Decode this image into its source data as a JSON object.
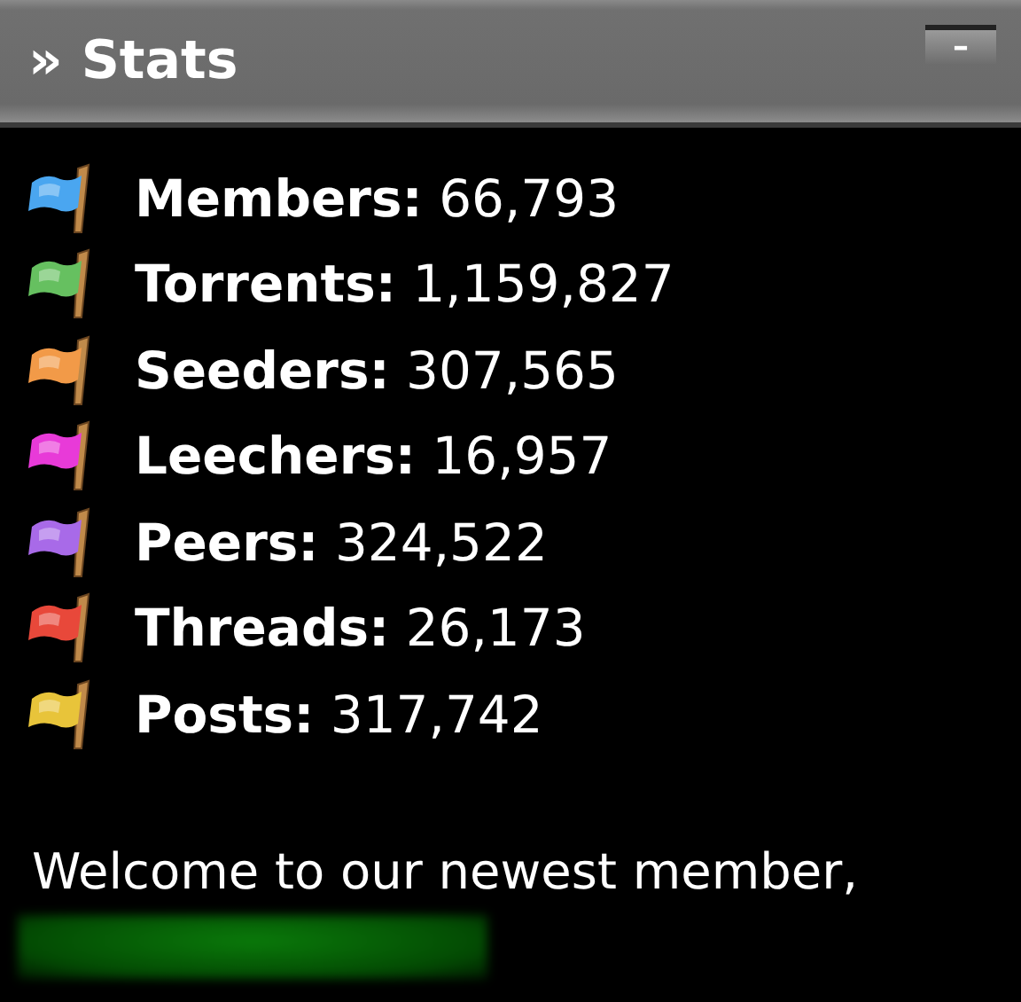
{
  "panel": {
    "title": "» Stats",
    "collapse_button": "–"
  },
  "stats": [
    {
      "label": "Members:",
      "value": "66,793",
      "color": "#4aa6f0"
    },
    {
      "label": "Torrents:",
      "value": "1,159,827",
      "color": "#66c060"
    },
    {
      "label": "Seeders:",
      "value": "307,565",
      "color": "#f29a48"
    },
    {
      "label": "Leechers:",
      "value": "16,957",
      "color": "#e83ad8"
    },
    {
      "label": "Peers:",
      "value": "324,522",
      "color": "#a86ae8"
    },
    {
      "label": "Threads:",
      "value": "26,173",
      "color": "#e8483a"
    },
    {
      "label": "Posts:",
      "value": "317,742",
      "color": "#e8c43a"
    }
  ],
  "welcome": "Welcome to our newest member,"
}
